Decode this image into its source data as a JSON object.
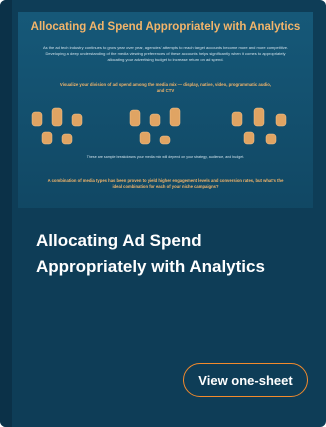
{
  "thumbnail": {
    "title": "Allocating Ad Spend Appropriately with Analytics",
    "intro": "As the ad tech industry continues to grow year over year, agencies' attempts to reach target accounts become more and more competitive. Developing a deep understanding of the media viewing preferences of these accounts helps significantly when it comes to appropriately allocating your advertising budget to increase return on ad spend.",
    "subheading": "Visualize your division of ad spend among the media mix — display, native, video, programmatic audio, and CTV",
    "note": "These are sample breakdowns your media mix will depend on your strategy, audience, and budget.",
    "bottom_text": "A combination of media types has been proven to yield higher engagement levels and conversion rates, but what's the ideal combination for each of your niche campaigns?"
  },
  "card": {
    "title": "Allocating Ad Spend Appropriately with Analytics",
    "cta_label": "View one-sheet"
  },
  "colors": {
    "card_background": "#0e3d57",
    "accent": "#f28a2c",
    "thumbnail_heading": "#f3b56a"
  }
}
